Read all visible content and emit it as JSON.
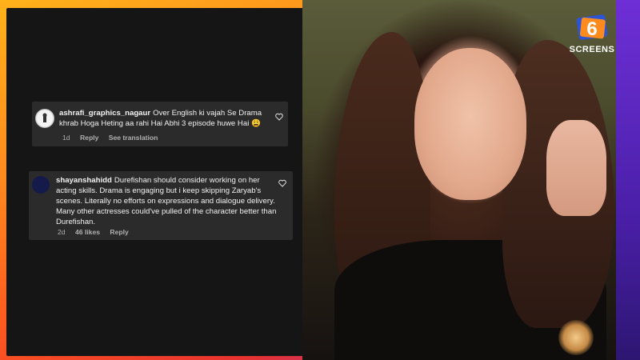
{
  "logo": {
    "text": "SCREENS",
    "mark": "6",
    "colors": {
      "accent": "#ff8a1e",
      "blue": "#2b55d6"
    }
  },
  "comments": [
    {
      "username": "ashrafi_graphics_nagaur",
      "text": "Over English ki vajah Se Drama khrab Hoga Heting aa rahi Hai Abhi 3 episode huwe Hai 😩",
      "age": "1d",
      "reply": "Reply",
      "translate": "See translation",
      "like_icon": "heart-outline-icon"
    },
    {
      "username": "shayanshahidd",
      "text": "Durefishan should consider working on her acting skills. Drama is engaging but i keep skipping Zaryab's scenes. Literally no efforts on expressions and dialogue delivery. Many other actresses could've pulled of the character better than Durefishan.",
      "age": "2d",
      "likes": "46 likes",
      "reply": "Reply",
      "like_icon": "heart-outline-icon"
    }
  ],
  "colors": {
    "frame_orange": "#ff8a1e",
    "frame_purple": "#6e2fd6",
    "panel": "#151515",
    "card": "#2b2b2b"
  }
}
